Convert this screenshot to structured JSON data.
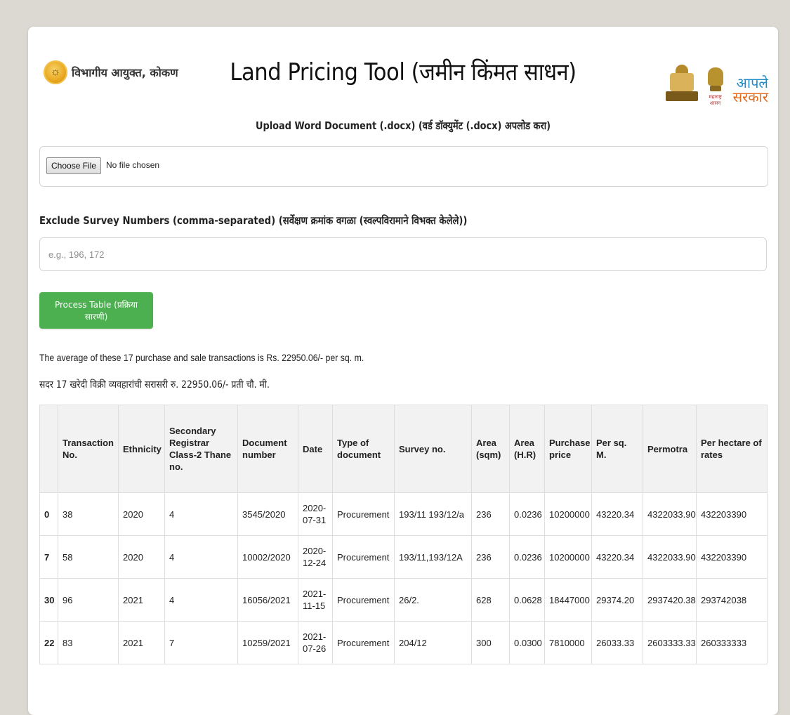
{
  "header": {
    "left_logo_text": "विभागीय आयुक्त, कोकण",
    "title": "Land Pricing Tool (जमीन किंमत साधन)",
    "emblem_caption": "महाराष्ट्र शासन",
    "aaple_line1": "आपले",
    "aaple_line2": "सरकार"
  },
  "upload": {
    "label": "Upload Word Document (.docx) (वर्ड डॉक्युमेंट (.docx) अपलोड करा)",
    "button_label": "Choose File",
    "status": "No file chosen"
  },
  "exclude": {
    "label": "Exclude Survey Numbers (comma-separated) (सर्वेक्षण क्रमांक वगळा (स्वल्पविरामाने विभक्त केलेले))",
    "placeholder": "e.g., 196, 172",
    "value": ""
  },
  "process_button": "Process Table (प्रक्रिया सारणी)",
  "summary": {
    "english": "The average of these 17 purchase and sale transactions is Rs. 22950.06/- per sq. m.",
    "marathi": "सदर 17 खरेदी विक्री व्यवहारांची सरासरी रु. 22950.06/- प्रती चौ. मी."
  },
  "table": {
    "columns": [
      "",
      "Transaction No.",
      "Ethnicity",
      "Secondary Registrar Class-2 Thane no.",
      "Document number",
      "Date",
      "Type of document",
      "Survey no.",
      "Area (sqm)",
      "Area (H.R)",
      "Purchase price",
      "Per sq. M.",
      "Permotra",
      "Per hectare of rates"
    ],
    "rows": [
      [
        "0",
        "38",
        "2020",
        "4",
        "3545/2020",
        "2020-07-31",
        "Procurement",
        "193/11 193/12/a",
        "236",
        "0.0236",
        "10200000",
        "43220.34",
        "4322033.90",
        "432203390"
      ],
      [
        "7",
        "58",
        "2020",
        "4",
        "10002/2020",
        "2020-12-24",
        "Procurement",
        "193/11,193/12A",
        "236",
        "0.0236",
        "10200000",
        "43220.34",
        "4322033.90",
        "432203390"
      ],
      [
        "30",
        "96",
        "2021",
        "4",
        "16056/2021",
        "2021-11-15",
        "Procurement",
        "26/2.",
        "628",
        "0.0628",
        "18447000",
        "29374.20",
        "2937420.38",
        "293742038"
      ],
      [
        "22",
        "83",
        "2021",
        "7",
        "10259/2021",
        "2021-07-26",
        "Procurement",
        "204/12",
        "300",
        "0.0300",
        "7810000",
        "26033.33",
        "2603333.33",
        "260333333"
      ]
    ]
  },
  "colors": {
    "page_bg": "#dcd8d2",
    "card_bg": "#ffffff",
    "accent_green": "#4caf50",
    "table_header_bg": "#f2f2f2"
  }
}
